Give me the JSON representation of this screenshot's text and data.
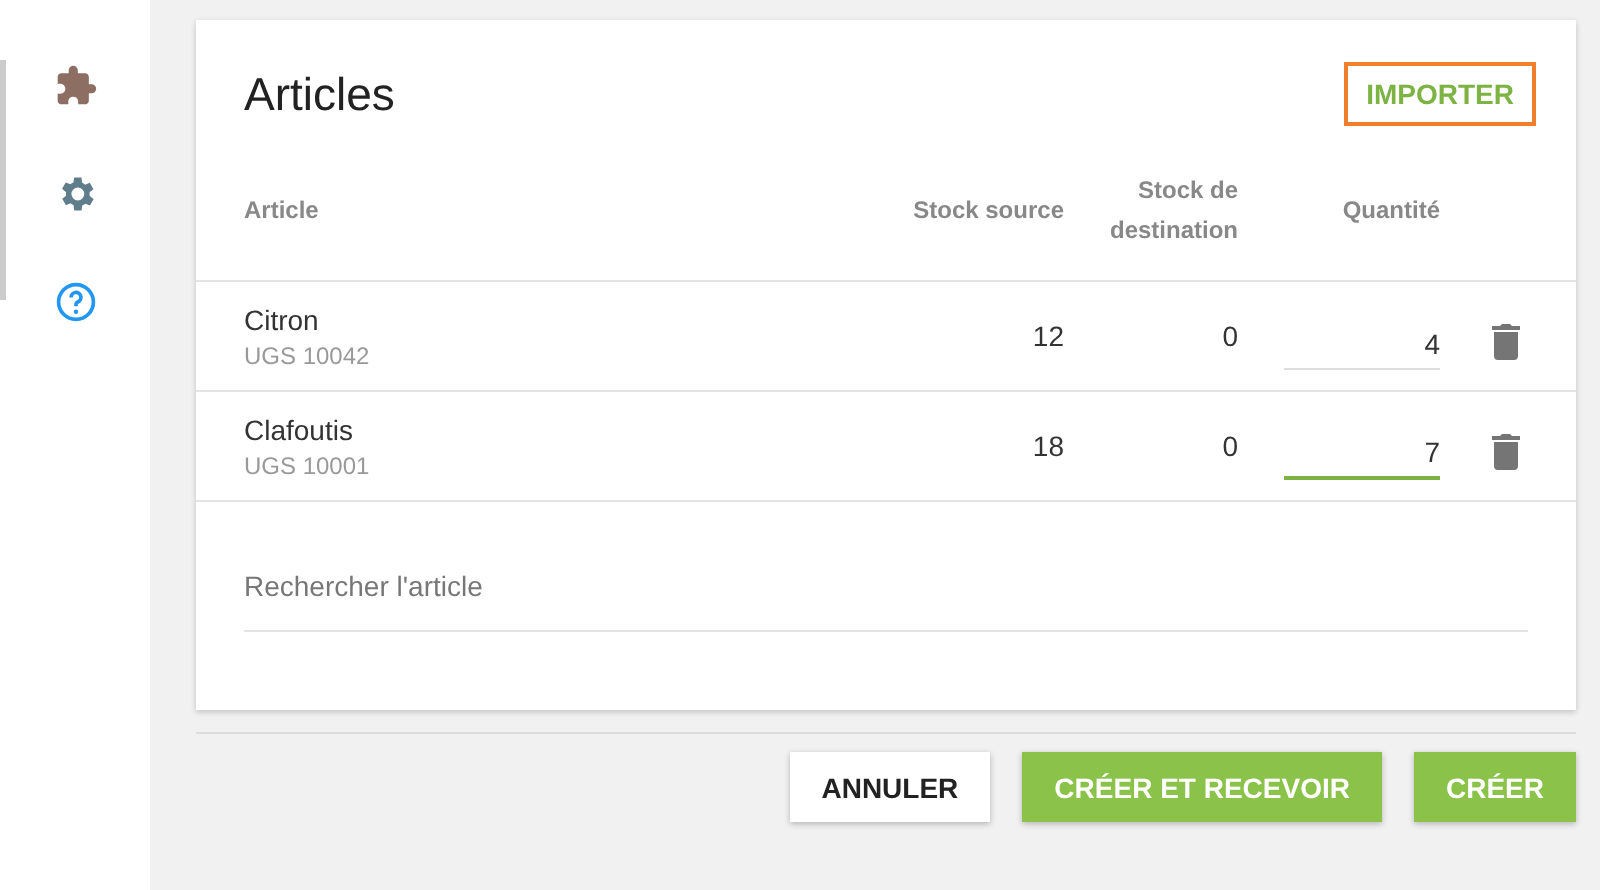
{
  "sidebar": {
    "items": [
      {
        "kind": "puzzle"
      },
      {
        "kind": "gear"
      },
      {
        "kind": "help"
      }
    ]
  },
  "card": {
    "title": "Articles",
    "import_button": {
      "label": "IMPORTER",
      "highlighted": true
    },
    "columns": [
      "Article",
      "Stock source",
      "Stock de destination",
      "Quantité"
    ],
    "rows": [
      {
        "name": "Citron",
        "sku": "UGS 10042",
        "source": "12",
        "destination": "0",
        "quantity": "4",
        "focused": false
      },
      {
        "name": "Clafoutis",
        "sku": "UGS 10001",
        "source": "18",
        "destination": "0",
        "quantity": "7",
        "focused": true
      }
    ],
    "search": {
      "placeholder": "Rechercher l'article"
    }
  },
  "buttons": [
    {
      "label": "ANNULER",
      "kind": "secondary"
    },
    {
      "label": "CRÉER ET RECEVOIR",
      "kind": "primary"
    },
    {
      "label": "CRÉER",
      "kind": "primary"
    }
  ]
}
